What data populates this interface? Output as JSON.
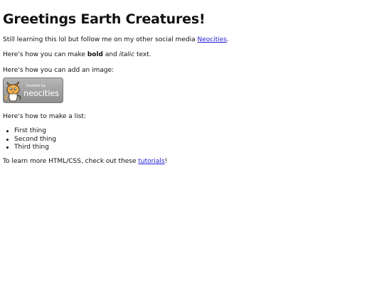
{
  "page": {
    "heading": "Greetings Earth Creatures!",
    "intro": {
      "before_link": "Still learning this lol but follow me on my other social media ",
      "link_text": "Neocities",
      "after_link": "."
    },
    "formatting": {
      "before_bold": "Here's how you can make ",
      "bold_text": "bold",
      "middle": " and ",
      "italic_text": "italic",
      "after_italic": " text."
    },
    "image_intro": "Here's how you can add an image:",
    "badge": {
      "text_small": "hosted by",
      "text_big": "neocities"
    },
    "list_intro": "Here's how to make a list:",
    "list_items": [
      "First thing",
      "Second thing",
      "Third thing"
    ],
    "outro": {
      "before_link": "To learn more HTML/CSS, check out these ",
      "link_text": "tutorials",
      "after_link": "!"
    }
  }
}
